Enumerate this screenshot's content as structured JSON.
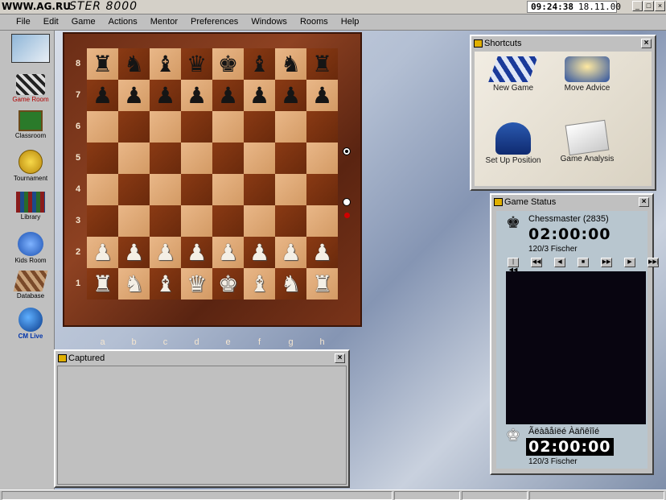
{
  "titlebar": {
    "watermark": "WWW.AG.RU",
    "app_title": "STER 8000",
    "clock_time": "09:24:38",
    "clock_date": "18.11.00",
    "min_glyph": "_",
    "max_glyph": "□",
    "close_glyph": "×"
  },
  "menu": {
    "items": [
      "File",
      "Edit",
      "Game",
      "Actions",
      "Mentor",
      "Preferences",
      "Windows",
      "Rooms",
      "Help"
    ]
  },
  "sidebar": {
    "items": [
      "Game Room",
      "Classroom",
      "Tournament",
      "Library",
      "Kids Room",
      "Database",
      "CM Live"
    ]
  },
  "board": {
    "ranks": [
      "8",
      "7",
      "6",
      "5",
      "4",
      "3",
      "2",
      "1"
    ],
    "files": [
      "a",
      "b",
      "c",
      "d",
      "e",
      "f",
      "g",
      "h"
    ],
    "black_back": [
      "♜",
      "♞",
      "♝",
      "♛",
      "♚",
      "♝",
      "♞",
      "♜"
    ],
    "black_pawn": "♟",
    "white_back": [
      "♜",
      "♞",
      "♝",
      "♛",
      "♚",
      "♝",
      "♞",
      "♜"
    ],
    "white_pawn": "♟"
  },
  "shortcuts": {
    "title": "Shortcuts",
    "items": [
      "New Game",
      "Move Advice",
      "Set Up Position",
      "Game Analysis"
    ]
  },
  "game_status": {
    "title": "Game Status",
    "top_player": "Chessmaster (2835)",
    "top_clock": "02:00:00",
    "top_control": "120/3 Fischer",
    "bottom_player": "Ãëàâåíëé Àäñêîîé",
    "bottom_clock": "02:00:00",
    "bottom_control": "120/3 Fischer",
    "controls": [
      "|◀◀",
      "◀◀",
      "◀",
      "■",
      "▶▶",
      "▶",
      "▶▶|"
    ]
  },
  "captured": {
    "title": "Captured"
  },
  "colors": {
    "light_square": "#e0ad7b",
    "dark_square": "#7a3211",
    "frame": "#6b2d16",
    "chrome": "#c0c0c0"
  }
}
